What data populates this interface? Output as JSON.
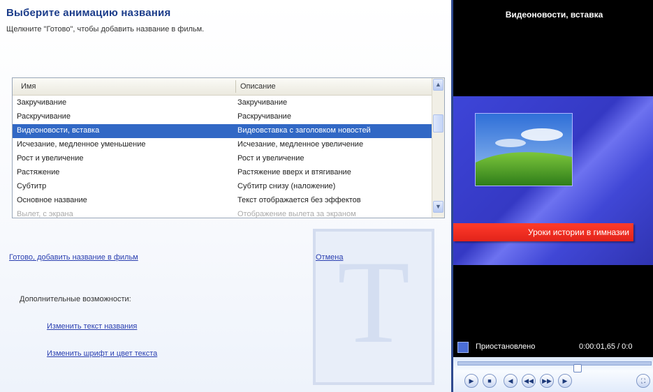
{
  "header": {
    "title": "Выберите анимацию названия",
    "subtitle": "Щелкните \"Готово\", чтобы добавить название в фильм."
  },
  "list": {
    "columns": [
      "Имя",
      "Описание"
    ],
    "rows": [
      {
        "name": "Закручивание",
        "desc": "Закручивание"
      },
      {
        "name": "Раскручивание",
        "desc": "Раскручивание"
      },
      {
        "name": "Видеоновости, вставка",
        "desc": "Видеовставка с заголовком новостей"
      },
      {
        "name": "Исчезание, медленное уменьшение",
        "desc": "Исчезание, медленное увеличение"
      },
      {
        "name": "Рост и увеличение",
        "desc": "Рост и увеличение"
      },
      {
        "name": "Растяжение",
        "desc": "Растяжение вверх и втягивание"
      },
      {
        "name": "Субтитр",
        "desc": "Субтитр снизу (наложение)"
      },
      {
        "name": "Основное название",
        "desc": "Текст отображается без эффектов"
      },
      {
        "name": "Вылет, с экрана",
        "desc": "Отображение вылета за экраном"
      }
    ],
    "selected_index": 2
  },
  "actions": {
    "done_link": "Готово, добавить название в фильм",
    "cancel_link": "Отмена"
  },
  "more_options": {
    "label": "Дополнительные возможности:",
    "change_text": "Изменить текст названия",
    "change_font": "Изменить шрифт и цвет текста"
  },
  "preview": {
    "title": "Видеоновости, вставка",
    "overlay_text": "Уроки истории в гимназии",
    "status": "Приостановлено",
    "time": "0:00:01,65 / 0:0",
    "seek_fraction": 0.62
  },
  "colors": {
    "selection": "#3168c5",
    "title": "#1b3c8a",
    "banner": "#e2231a",
    "video_bg": "#3d45d8"
  },
  "icons": [
    "scroll-up-icon",
    "scroll-down-icon",
    "play-icon",
    "stop-icon",
    "previous-frame-icon",
    "rewind-icon",
    "forward-icon",
    "next-frame-icon",
    "fullscreen-icon",
    "status-icon"
  ]
}
